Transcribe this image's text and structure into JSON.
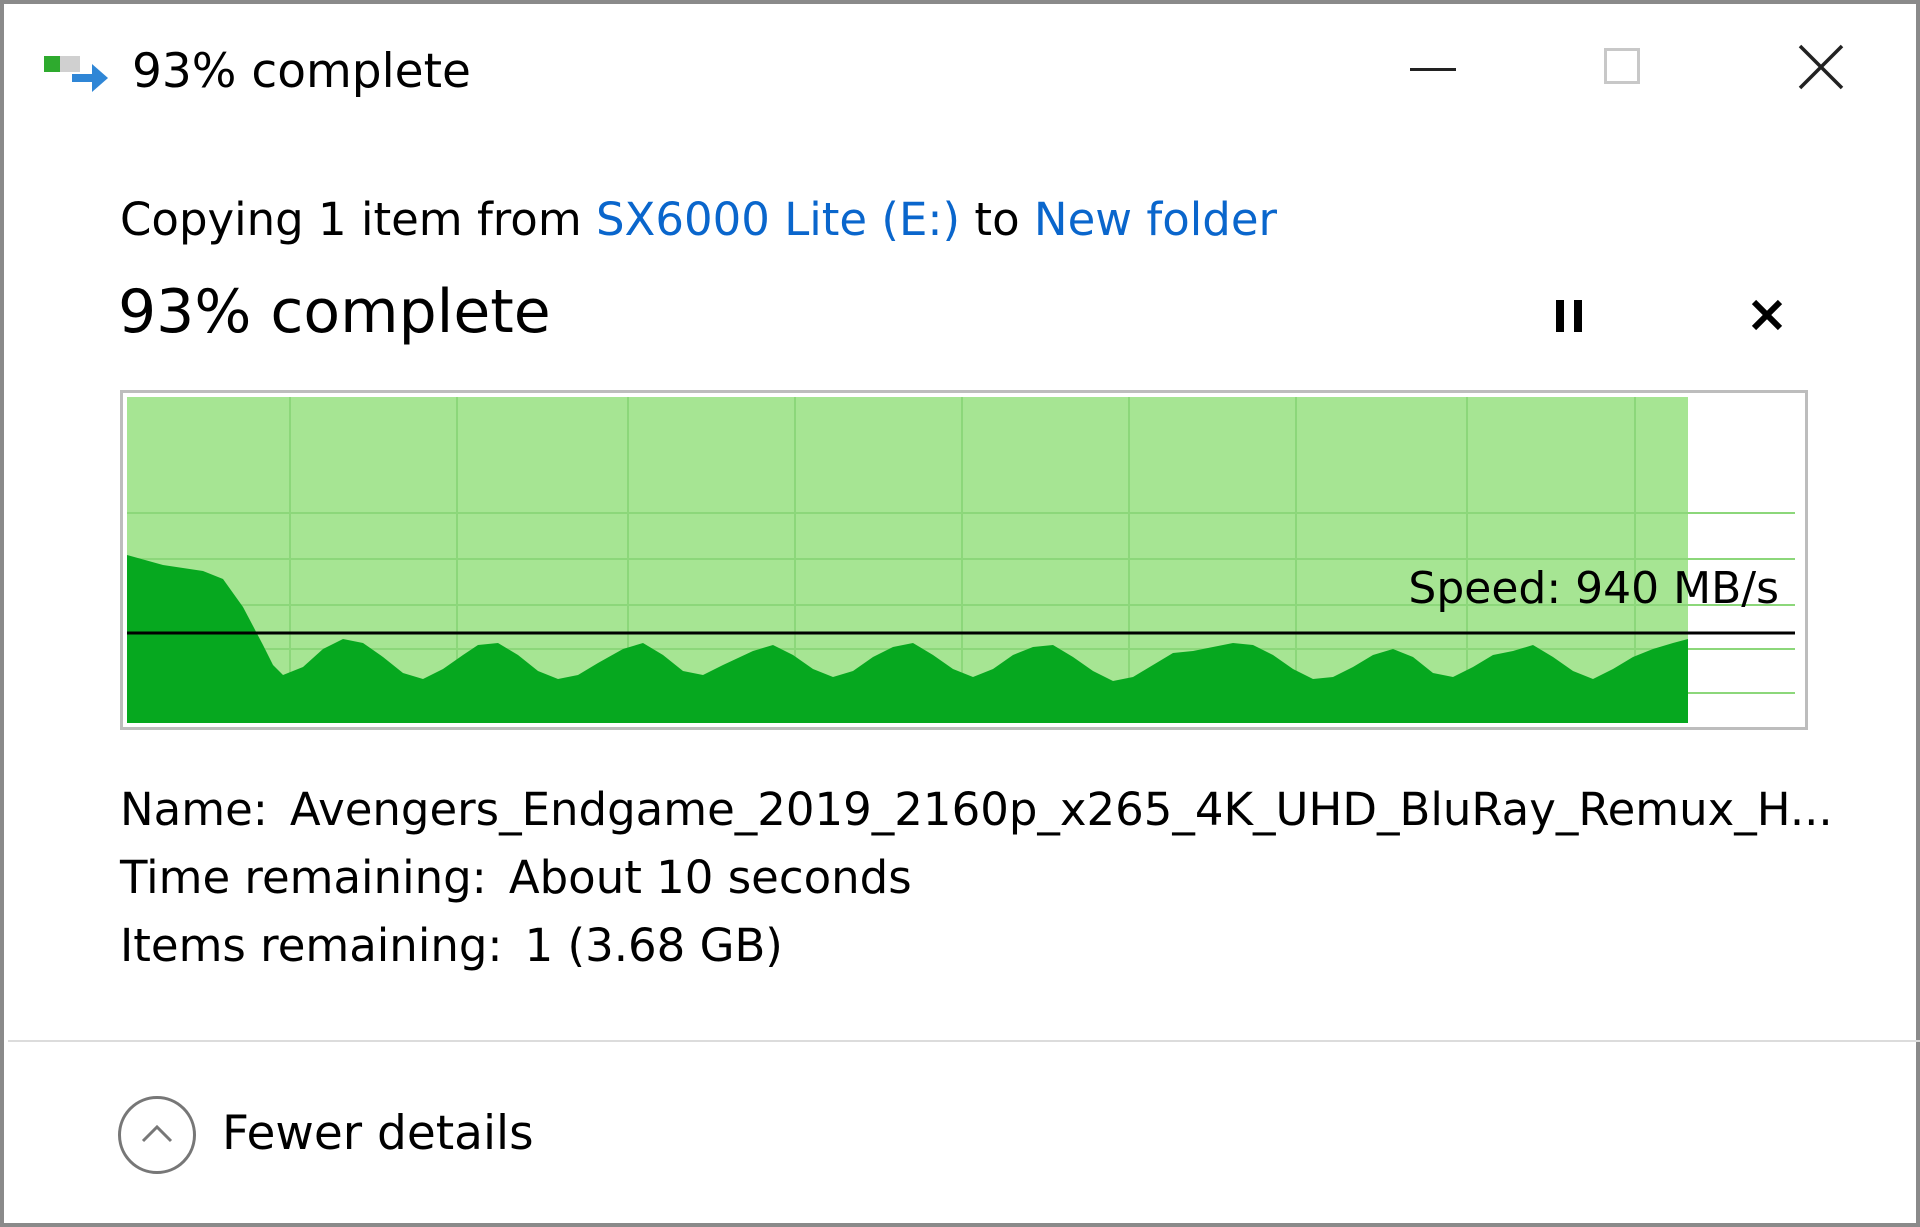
{
  "window": {
    "title": "93% complete",
    "icon": "file-copy-icon",
    "controls": {
      "minimize": "minimize-icon",
      "maximize": "maximize-icon",
      "close": "close-icon"
    }
  },
  "header": {
    "prefix": "Copying 1 item from ",
    "source": "SX6000 Lite (E:)",
    "middle": " to ",
    "destination": "New folder"
  },
  "progress": {
    "label": "93% complete",
    "fraction": 0.93,
    "pause_icon": "pause-icon",
    "cancel_icon": "cancel-icon"
  },
  "graph": {
    "speed_label": "Speed: 940 MB/s",
    "colors": {
      "fill_done": "#a6e593",
      "speed_area": "#06a81f",
      "grid": "#8cd77a",
      "speed_line": "#000000"
    }
  },
  "details": {
    "name_label": "Name:",
    "name_value": "Avengers_Endgame_2019_2160p_x265_4K_UHD_BluRay_Remux_H...",
    "time_label": "Time remaining:",
    "time_value": "About 10 seconds",
    "items_label": "Items remaining:",
    "items_value": "1 (3.68 GB)"
  },
  "footer": {
    "toggle_label": "Fewer details",
    "toggle_icon": "chevron-up-icon"
  }
}
